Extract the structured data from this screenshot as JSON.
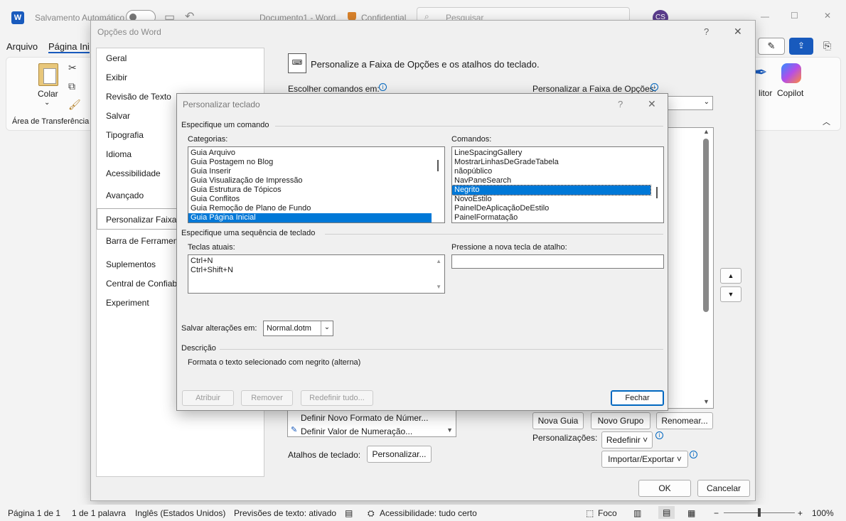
{
  "titlebar": {
    "autosave_label": "Salvamento Automático",
    "doc_title": "Documento1 - Word",
    "sensitivity": "Confidential",
    "search_placeholder": "Pesquisar",
    "user_initials": "CS"
  },
  "ribbon": {
    "tabs": [
      "Arquivo",
      "Página Ini"
    ],
    "paste_label": "Colar",
    "clipboard_group": "Área de Transferência",
    "editor_label": "litor",
    "copilot_label": "Copilot"
  },
  "options_dialog": {
    "title": "Opções do Word",
    "help": "?",
    "close": "✕",
    "nav_items": [
      "Geral",
      "Exibir",
      "Revisão de Texto",
      "Salvar",
      "Tipografia",
      "Idioma",
      "Acessibilidade",
      "Avançado",
      "Personalizar Faixa d",
      "Barra de Ferrament",
      "Suplementos",
      "Central de Confiabi",
      "Experiment"
    ],
    "header": "Personalize a Faixa de Opções e os atalhos do teclado.",
    "choose_commands_label": "Escolher comandos em:",
    "customize_ribbon_label": "Personalizar a Faixa de Opções:",
    "bg_list_items": [
      "Definir Novo Formato de Númer...",
      "Definir Valor de Numeração..."
    ],
    "keyboard_shortcuts_label": "Atalhos de teclado:",
    "customize_button": "Personalizar...",
    "new_tab_button": "Nova Guia",
    "new_group_button": "Novo Grupo",
    "rename_button": "Renomear...",
    "customizations_label": "Personalizações:",
    "reset_button": "Redefinir ˅",
    "import_export_button": "Importar/Exportar ˅",
    "ok_button": "OK",
    "cancel_button": "Cancelar"
  },
  "keyboard_dialog": {
    "title": "Personalizar teclado",
    "help": "?",
    "close": "✕",
    "specify_command": "Especifique um comando",
    "categories_label": "Categorias:",
    "categories": [
      "Guia Arquivo",
      "Guia Postagem no Blog",
      "Guia Inserir",
      "Guia Visualização de Impressão",
      "Guia Estrutura de Tópicos",
      "Guia Conflitos",
      "Guia Remoção de Plano de Fundo",
      "Guia Página Inicial"
    ],
    "categories_selected": 7,
    "commands_label": "Comandos:",
    "commands": [
      "LineSpacingGallery",
      "MostrarLinhasDeGradeTabela",
      "nãopúblico",
      "NavPaneSearch",
      "Negrito",
      "NovoEstilo",
      "PainelDeAplicaçãoDeEstilo",
      "PainelFormatação"
    ],
    "commands_selected": 4,
    "specify_sequence": "Especifique uma sequência de teclado",
    "current_keys_label": "Teclas atuais:",
    "current_keys": [
      "Ctrl+N",
      "Ctrl+Shift+N"
    ],
    "new_key_label": "Pressione a nova tecla de atalho:",
    "new_key_value": "",
    "save_changes_label": "Salvar alterações em:",
    "save_changes_value": "Normal.dotm",
    "description_label": "Descrição",
    "description_text": "Formata o texto selecionado com negrito (alterna)",
    "assign_button": "Atribuir",
    "remove_button": "Remover",
    "reset_all_button": "Redefinir tudo...",
    "close_button": "Fechar"
  },
  "statusbar": {
    "page": "Página 1 de 1",
    "words": "1 de 1 palavra",
    "language": "Inglês (Estados Unidos)",
    "predictions": "Previsões de texto: ativado",
    "accessibility": "Acessibilidade: tudo certo",
    "focus": "Foco",
    "zoom": "100%",
    "zoom_level": 0.5
  }
}
